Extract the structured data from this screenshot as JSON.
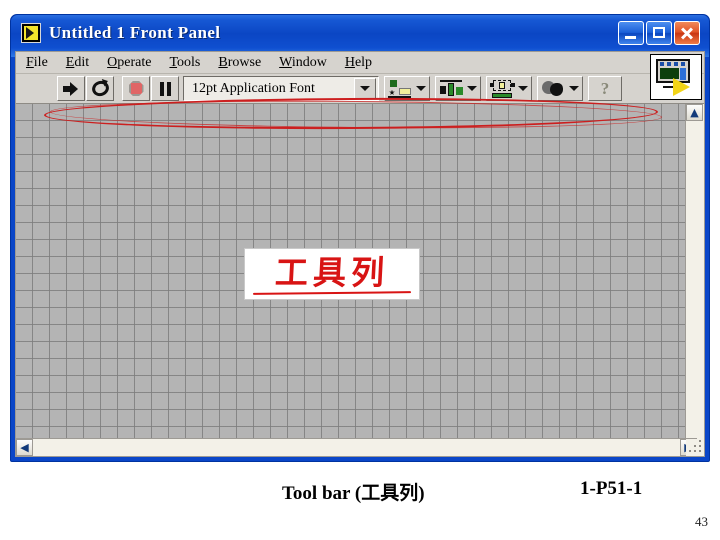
{
  "window": {
    "title": "Untitled 1 Front Panel",
    "app_icon": "labview-vi-icon",
    "controls": {
      "minimize": "minimize-button",
      "maximize": "maximize-button",
      "close": "close-button"
    }
  },
  "menubar": {
    "items": [
      {
        "label": "File",
        "mnemonic": "F"
      },
      {
        "label": "Edit",
        "mnemonic": "E"
      },
      {
        "label": "Operate",
        "mnemonic": "O"
      },
      {
        "label": "Tools",
        "mnemonic": "T"
      },
      {
        "label": "Browse",
        "mnemonic": "B"
      },
      {
        "label": "Window",
        "mnemonic": "W"
      },
      {
        "label": "Help",
        "mnemonic": "H"
      }
    ]
  },
  "toolbar": {
    "run_label": "Run",
    "run_continuous_label": "Run Continuously",
    "abort_label": "Abort Execution",
    "pause_label": "Pause",
    "font_combo": {
      "value": "12pt Application Font",
      "placeholder": "12pt Application Font"
    },
    "align_label": "Align Objects",
    "distribute_label": "Distribute Objects",
    "resize_label": "Resize Objects",
    "reorder_label": "Reorder",
    "help_label": "?",
    "corner_icon": "vi-connector-pane-icon"
  },
  "panel": {
    "annotation": {
      "text": "工具列",
      "color": "#d81414"
    },
    "ellipse_color": "#cc1f1f",
    "grid_color": "#7d7d7d",
    "background_color": "#b4b4b4"
  },
  "scrollbars": {
    "up": "▲",
    "down": "▼",
    "left": "◀",
    "right": "▶"
  },
  "caption": {
    "left": "Tool bar (工具列)",
    "right": "1-P51-1"
  },
  "page": {
    "number": "43"
  }
}
